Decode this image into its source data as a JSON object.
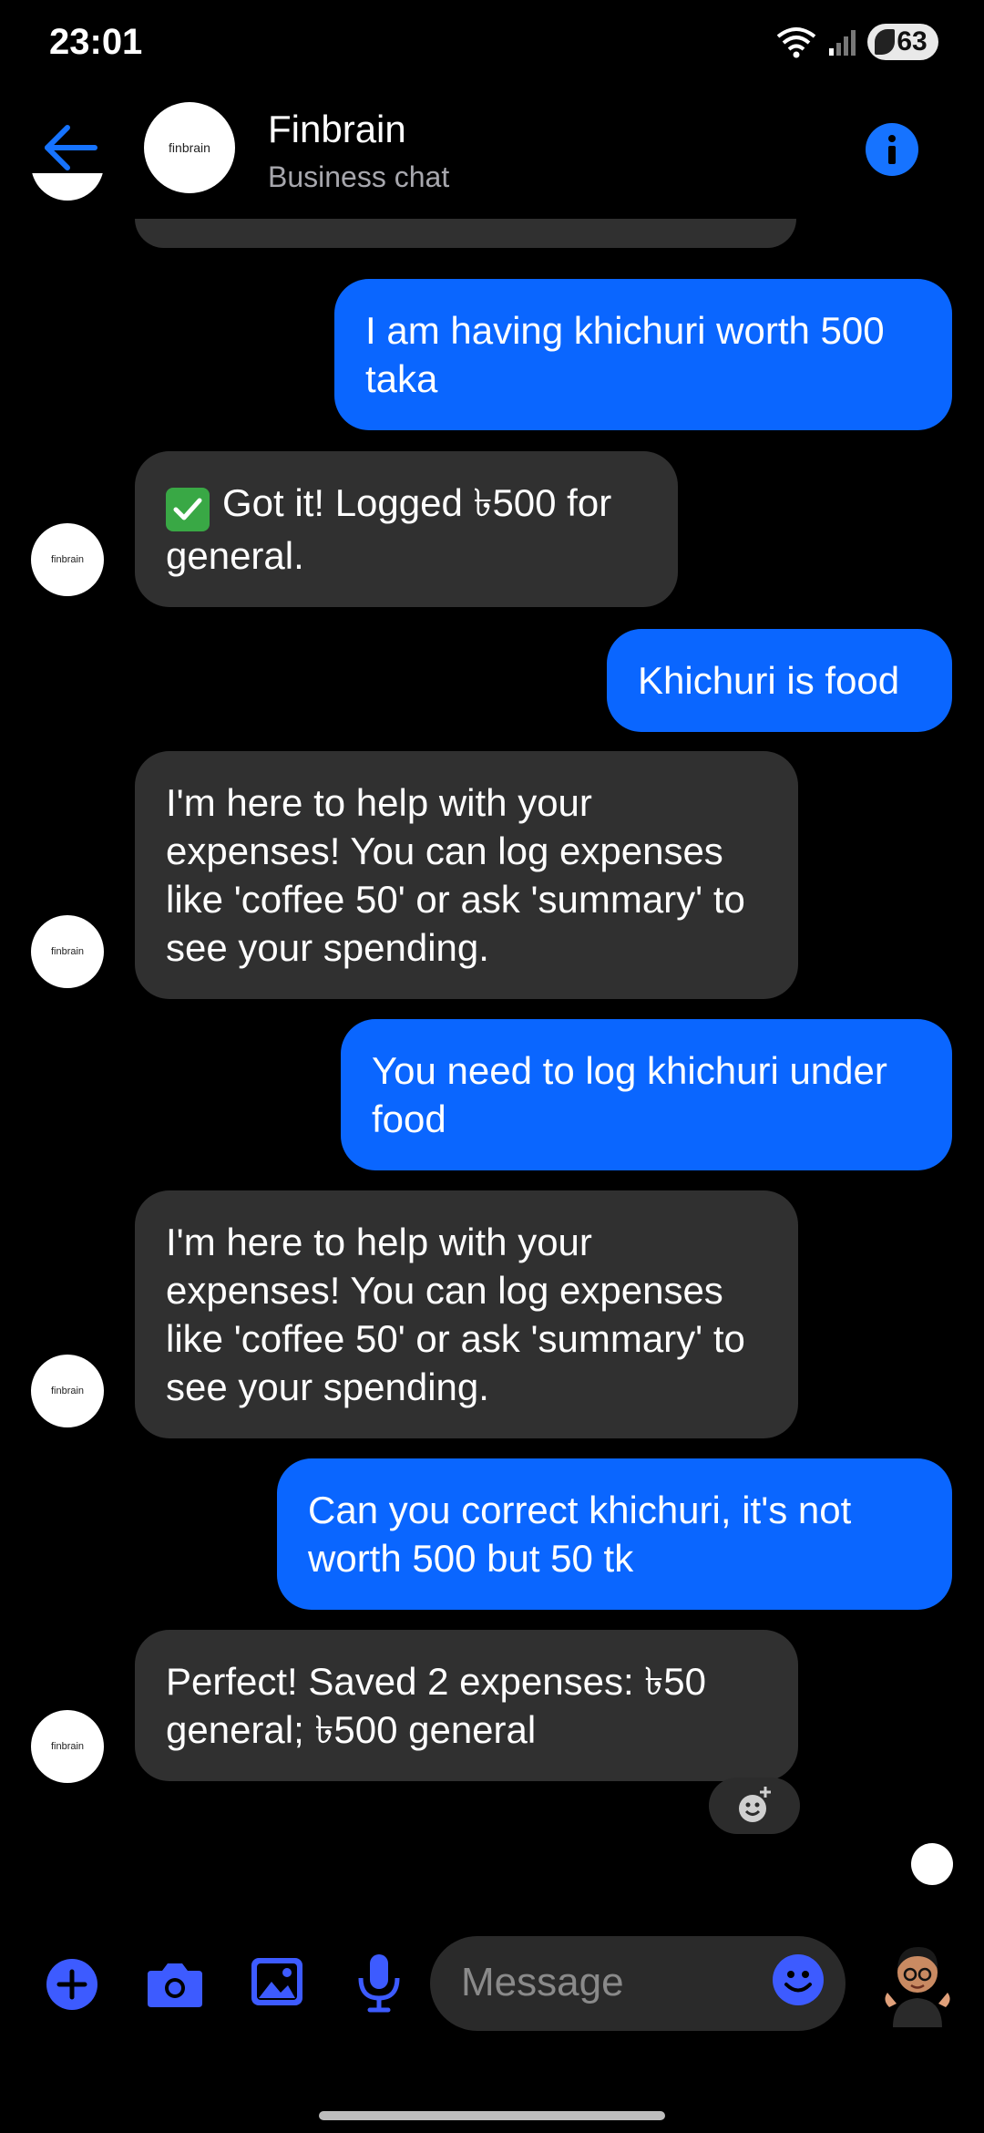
{
  "status_bar": {
    "time": "23:01",
    "battery": "63"
  },
  "header": {
    "avatar_text": "finbrain",
    "name": "Finbrain",
    "subtitle": "Business chat"
  },
  "messages": [
    {
      "side": "out",
      "text": "I am having khichuri worth 500 taka"
    },
    {
      "side": "in",
      "text": "Got it! Logged ৳500 for general.",
      "emoji": "check-mark-button"
    },
    {
      "side": "out",
      "text": "Khichuri is food"
    },
    {
      "side": "in",
      "text": "I'm here to help with your expenses! You can log expenses like 'coffee 50' or ask 'summary' to see your spending."
    },
    {
      "side": "out",
      "text": "You need to log khichuri under food"
    },
    {
      "side": "in",
      "text": "I'm here to help with your expenses! You can log expenses like 'coffee 50' or ask 'summary' to see your spending."
    },
    {
      "side": "out",
      "text": "Can you correct khichuri, it's not worth 500 but 50 tk"
    },
    {
      "side": "in",
      "text": "Perfect! Saved 2 expenses: ৳50 general; ৳500 general"
    }
  ],
  "composer": {
    "placeholder": "Message"
  },
  "colors": {
    "accent": "#0a66ff",
    "incoming_bubble": "#303030",
    "background": "#000000"
  }
}
